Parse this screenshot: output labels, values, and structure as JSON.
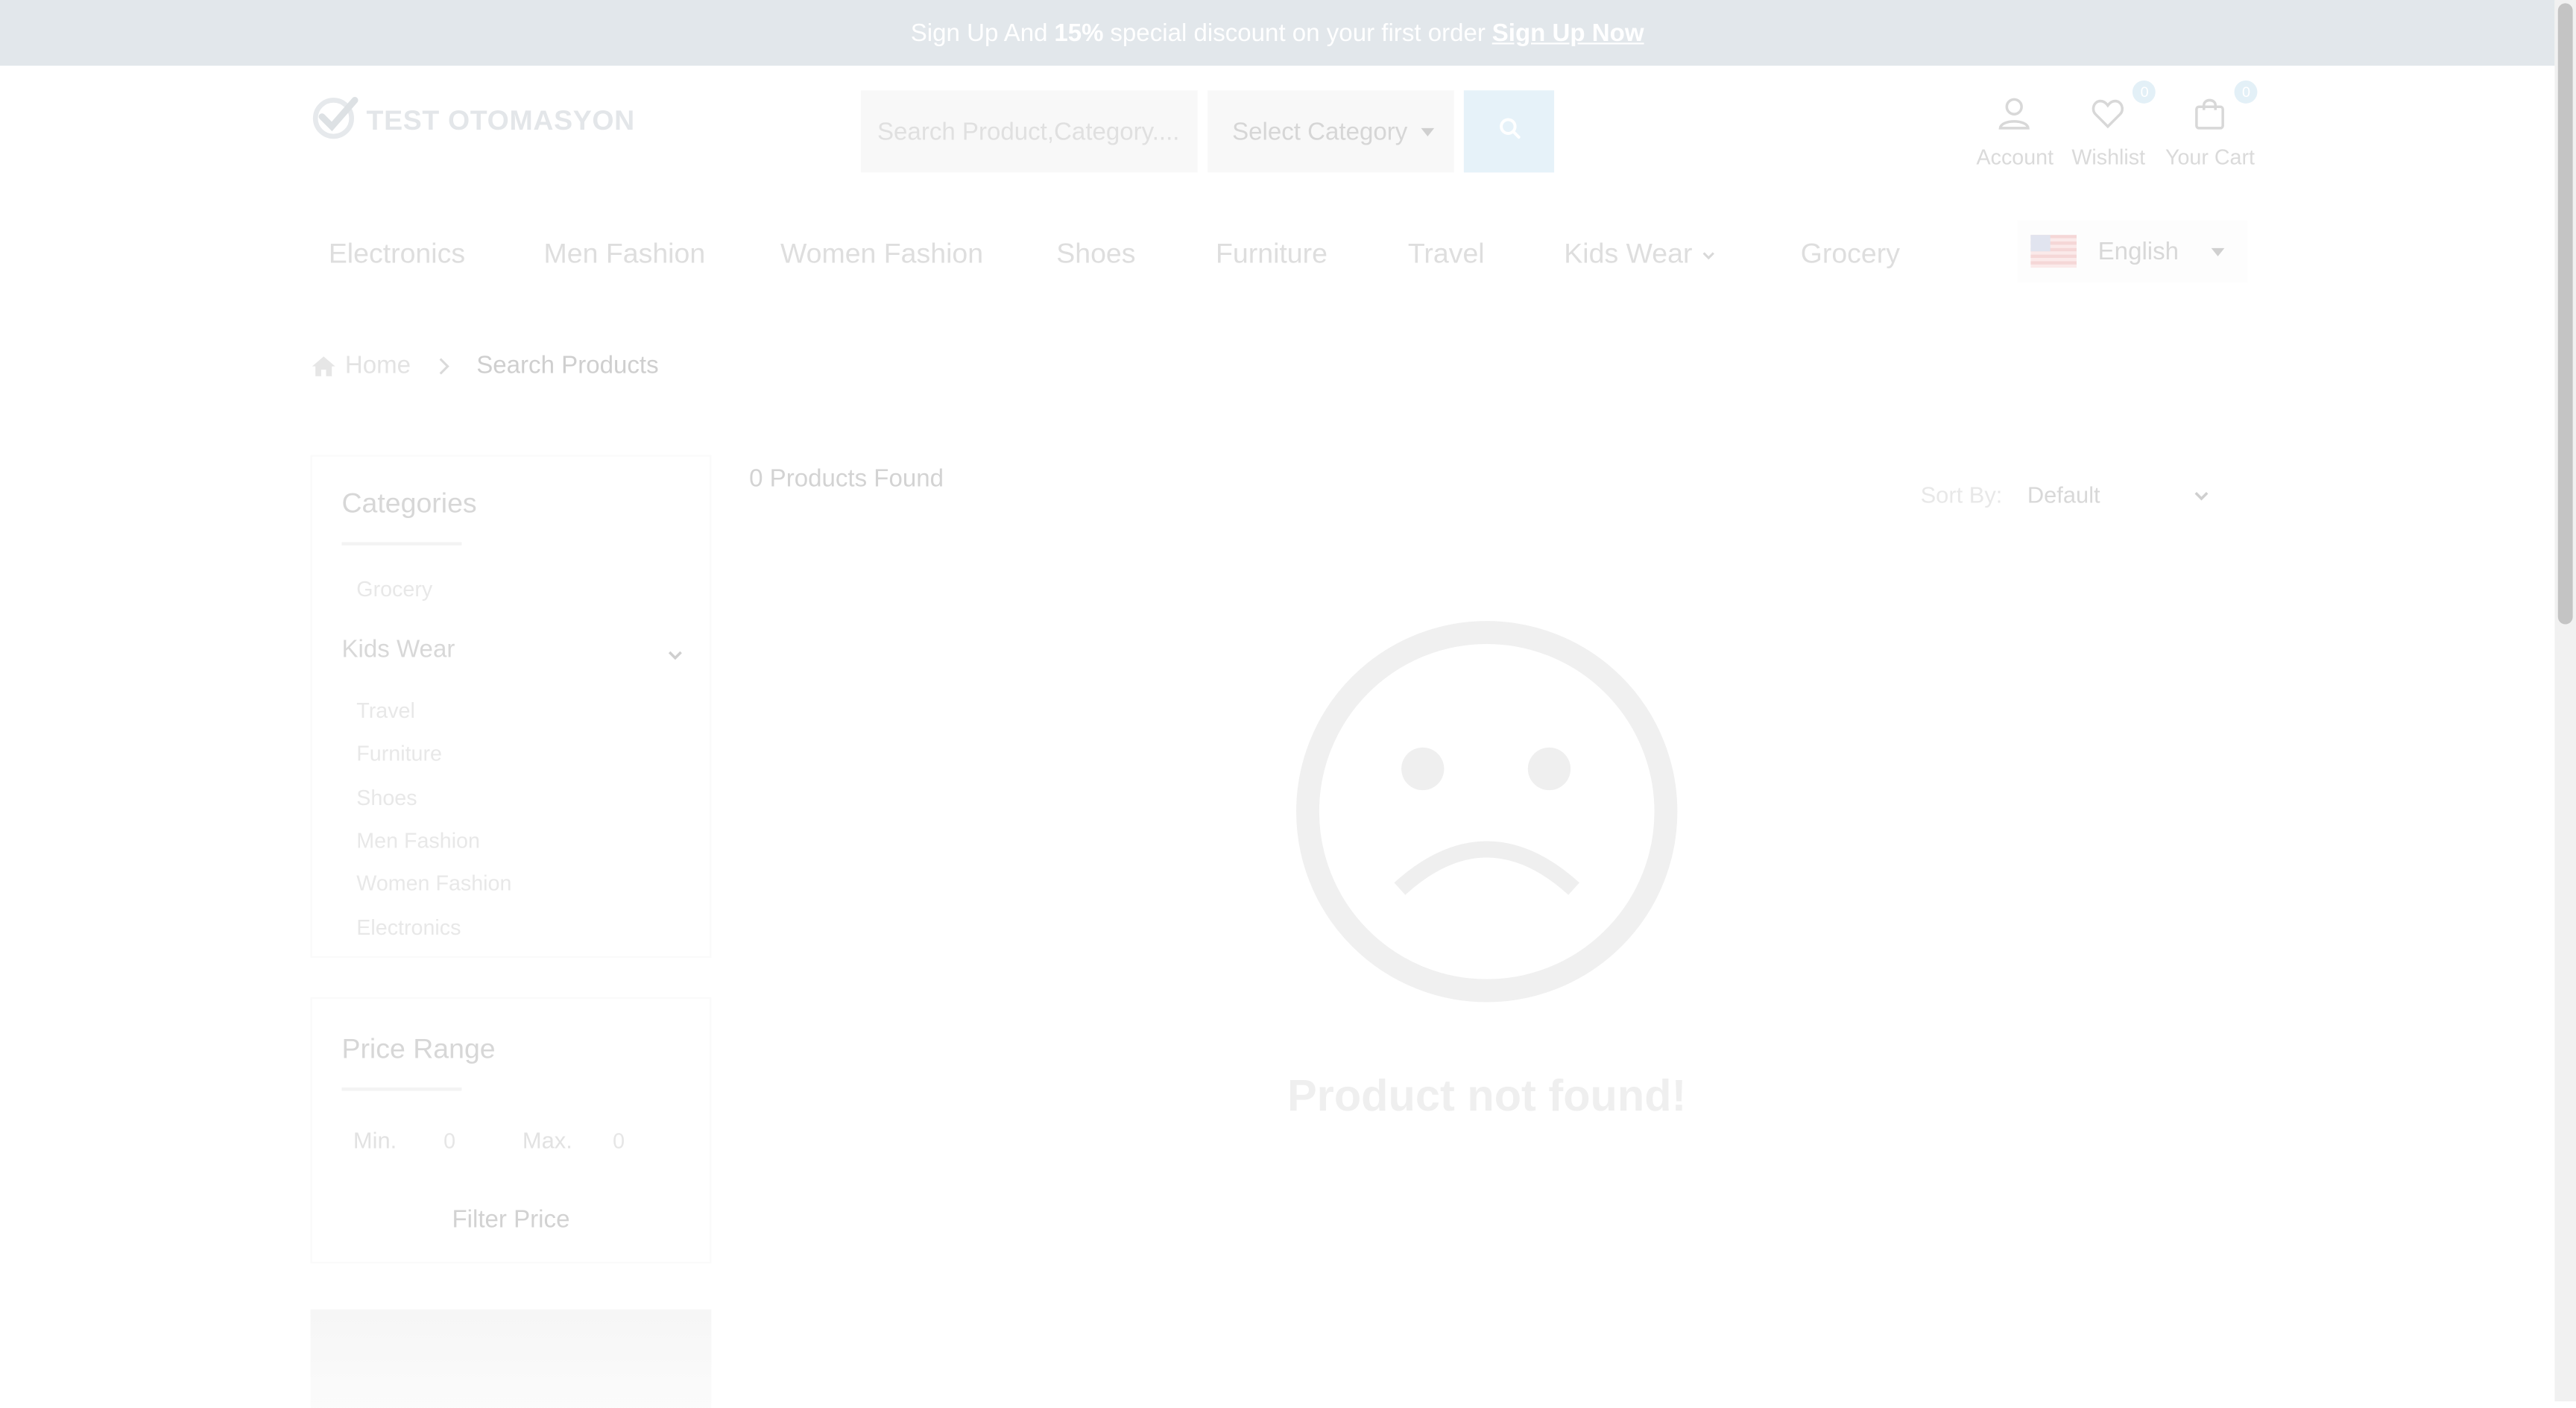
{
  "announcement": {
    "prefix": "Sign Up And",
    "highlight": "15%",
    "suffix": "special discount on your first order",
    "link": "Sign Up Now"
  },
  "header": {
    "logo_text": "TEST OTOMASYON",
    "search": {
      "placeholder": "Search Product,Category...."
    },
    "category_select": "Select Category",
    "account_label": "Account",
    "wishlist_label": "Wishlist",
    "wishlist_count": "0",
    "cart_label": "Your Cart",
    "cart_count": "0"
  },
  "nav": {
    "items": [
      "Electronics",
      "Men Fashion",
      "Women Fashion",
      "Shoes",
      "Furniture",
      "Travel",
      "Kids Wear",
      "Grocery"
    ],
    "language": "English"
  },
  "breadcrumb": {
    "home": "Home",
    "current": "Search Products"
  },
  "sidebar": {
    "categories_title": "Categories",
    "categories": [
      "Grocery",
      "Kids Wear",
      "Travel",
      "Furniture",
      "Shoes",
      "Men Fashion",
      "Women Fashion",
      "Electronics"
    ],
    "price_title": "Price Range",
    "min_label": "Min.",
    "min_value": "0",
    "max_label": "Max.",
    "max_value": "0",
    "filter_button": "Filter Price"
  },
  "content": {
    "found_text": "0 Products Found",
    "sort_label": "Sort By:",
    "sort_value": "Default",
    "not_found": "Product not found!"
  },
  "colors": {
    "topbar_bg": "#e2e7eb",
    "search_button_bg": "#e6f2f9",
    "faded_text": "#dedede"
  }
}
